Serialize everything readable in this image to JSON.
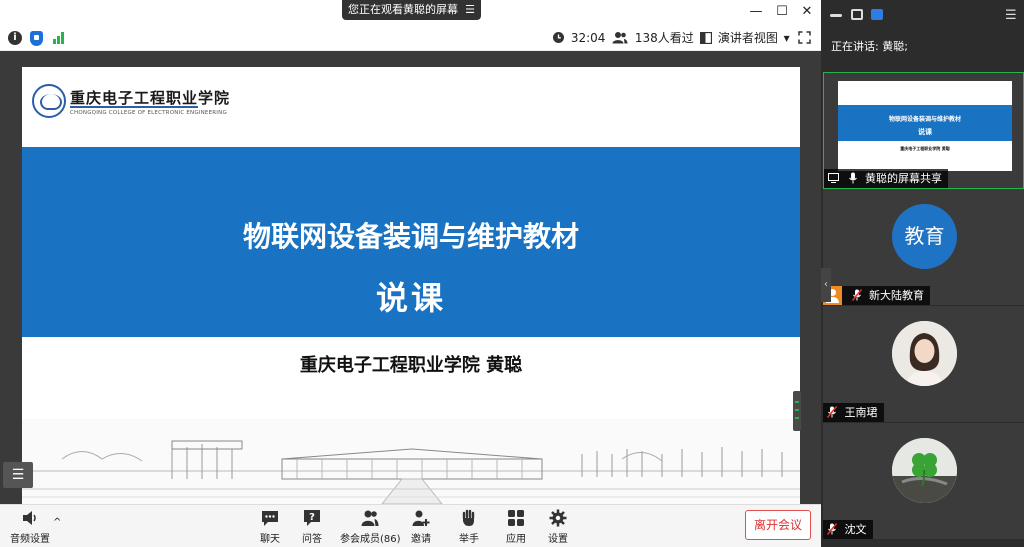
{
  "share_banner": {
    "text": "您正在观看黄聪的屏幕",
    "menu_glyph": "☰"
  },
  "window_controls": {
    "minimize": "—",
    "maximize": "☐",
    "close": "✕"
  },
  "infobar": {
    "timer": "32:04",
    "viewers": "138人看过",
    "view_mode": "演讲者视图",
    "view_mode_caret": "▾"
  },
  "slide": {
    "college_name_cn": "重庆电子工程职业学院",
    "college_name_en": "CHONGQING COLLEGE OF ELECTRONIC ENGINEERING",
    "title": "物联网设备装调与维护教材",
    "subtitle": "说课",
    "presenter": "重庆电子工程职业学院  黄聪"
  },
  "toolbar": {
    "audio": "音频设置",
    "chat": "聊天",
    "qa": "问答",
    "participants": "参会成员(86)",
    "invite": "邀请",
    "raise_hand": "举手",
    "apps": "应用",
    "settings": "设置",
    "leave": "离开会议"
  },
  "right_panel": {
    "speaking": "正在讲话:  黄聪;",
    "thumb_title": "物联网设备装调与维护教材",
    "thumb_subtitle": "说课",
    "thumb_presenter": "重庆电子工程职业学院  黄聪",
    "participants": [
      {
        "name": "黄聪的屏幕共享"
      },
      {
        "name": "新大陆教育",
        "avatar_text": "教育"
      },
      {
        "name": "王南珺"
      },
      {
        "name": "沈文"
      }
    ]
  },
  "colors": {
    "slide_band": "#1a73c2",
    "leave_red": "#e03030",
    "avatar_blue": "#1f73c4",
    "panel_dark": "#2c2c2c",
    "signal_green": "#2bb24c"
  },
  "icons": [
    "info-icon",
    "shield-icon",
    "signal-icon",
    "clock-icon",
    "people-icon",
    "presenter-view-icon",
    "fullscreen-icon",
    "audio-icon",
    "chat-icon",
    "qa-icon",
    "participants-icon",
    "invite-icon",
    "hand-icon",
    "apps-icon",
    "settings-icon",
    "mic-muted-icon",
    "screen-share-icon"
  ]
}
